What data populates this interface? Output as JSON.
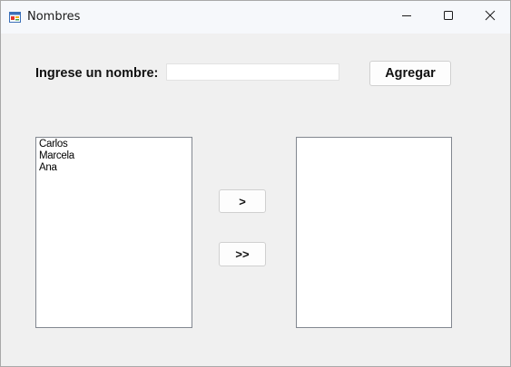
{
  "window": {
    "title": "Nombres",
    "icon": "windows-form-icon",
    "controls": {
      "minimize_icon": "minimize-icon",
      "maximize_icon": "maximize-icon",
      "close_icon": "close-icon"
    }
  },
  "form": {
    "name_label": "Ingrese un nombre:",
    "name_input_value": "",
    "add_button_label": "Agregar",
    "move_one_label": ">",
    "move_all_label": ">>"
  },
  "left_list": {
    "items": [
      "Carlos",
      "Marcela",
      "Ana"
    ]
  },
  "right_list": {
    "items": []
  },
  "colors": {
    "window_background": "#f0f0f0",
    "titlebar_background": "#f6f8fb",
    "listbox_border": "#828790"
  }
}
